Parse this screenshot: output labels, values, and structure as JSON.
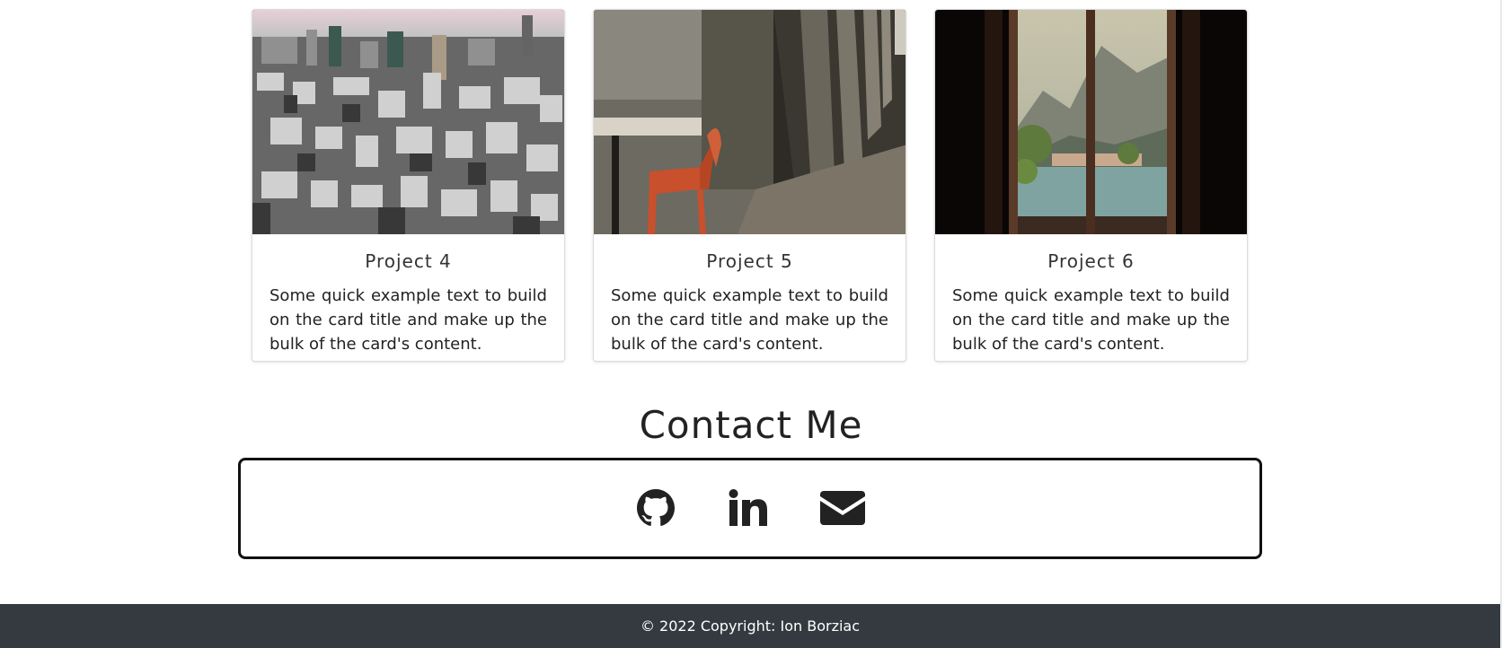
{
  "projects": [
    {
      "title": "Project 4",
      "text": "Some quick example text to build on the card title and make up the bulk of the card's content.",
      "image": "aerial-city-skyline-photo"
    },
    {
      "title": "Project 5",
      "text": "Some quick example text to build on the card title and make up the bulk of the card's content.",
      "image": "orange-chair-colonnade-photo"
    },
    {
      "title": "Project 6",
      "text": "Some quick example text to build on the card title and make up the bulk of the card's content.",
      "image": "window-lake-mountains-photo"
    }
  ],
  "contact": {
    "heading": "Contact Me",
    "icons": [
      "github-icon",
      "linkedin-icon",
      "envelope-icon"
    ]
  },
  "footer": {
    "copyright": "© 2022 Copyright:  Ion Borziac"
  },
  "colors": {
    "footer_bg": "#343a40",
    "icon": "#222222",
    "chair": "#c8502c"
  }
}
